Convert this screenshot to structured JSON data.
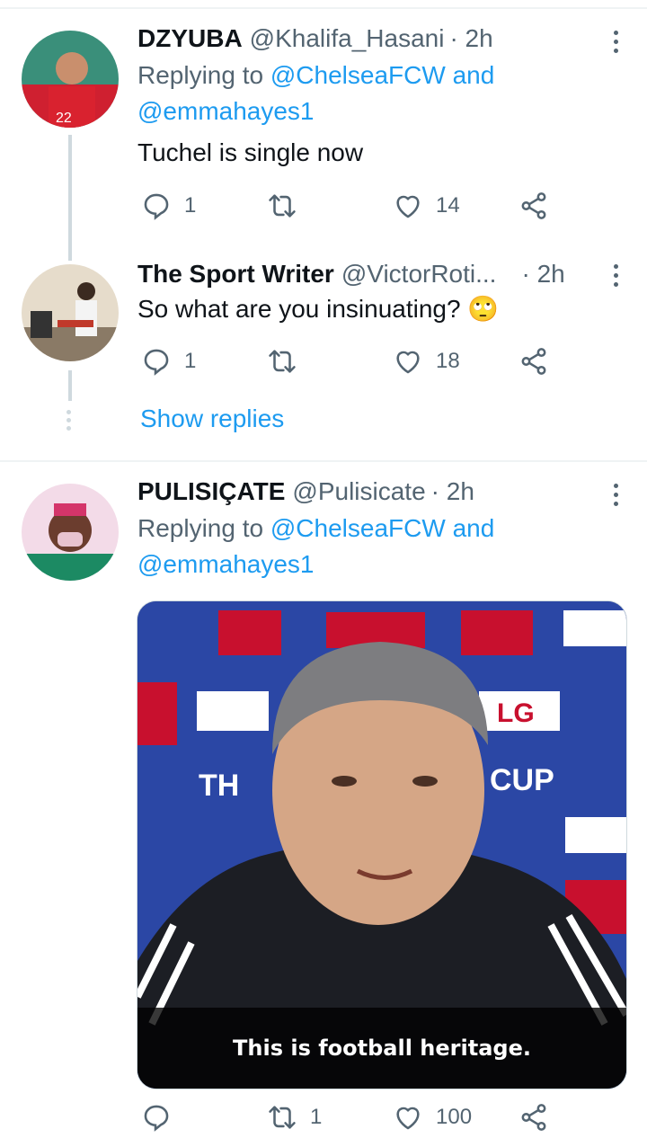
{
  "tweets": [
    {
      "name": "DZYUBA",
      "handle": "@Khalifa_Hasani",
      "time": "· 2h",
      "replying_prefix": "Replying to",
      "mention1": "@ChelseaFCW",
      "and": "and",
      "mention2": "@emmahayes1",
      "text": "Tuchel is single now",
      "counts": {
        "reply": "1",
        "retweet": "",
        "like": "14"
      }
    },
    {
      "name": "The Sport Writer",
      "handle": "@VictorRoti...",
      "time": "· 2h",
      "text": "So what are you insinuating? 🙄",
      "counts": {
        "reply": "1",
        "retweet": "",
        "like": "18"
      }
    },
    {
      "name": "PULISIÇATE",
      "handle": "@Pulisicate",
      "time": "· 2h",
      "replying_prefix": "Replying to",
      "mention1": "@ChelseaFCW",
      "and": "and",
      "mention2": "@emmahayes1",
      "video_caption": "This is football heritage.",
      "counts": {
        "reply": "",
        "retweet": "1",
        "like": "100"
      }
    }
  ],
  "show_replies": "Show replies",
  "media_backdrop_text": {
    "lg": "LG",
    "th": "TH",
    "cup": "CUP"
  },
  "colors": {
    "accent": "#1d9bf0",
    "secondary_text": "#536471",
    "primary_text": "#0f1419",
    "divider": "#eff3f4"
  },
  "icons": [
    "reply-icon",
    "retweet-icon",
    "like-icon",
    "share-icon",
    "more-icon"
  ]
}
